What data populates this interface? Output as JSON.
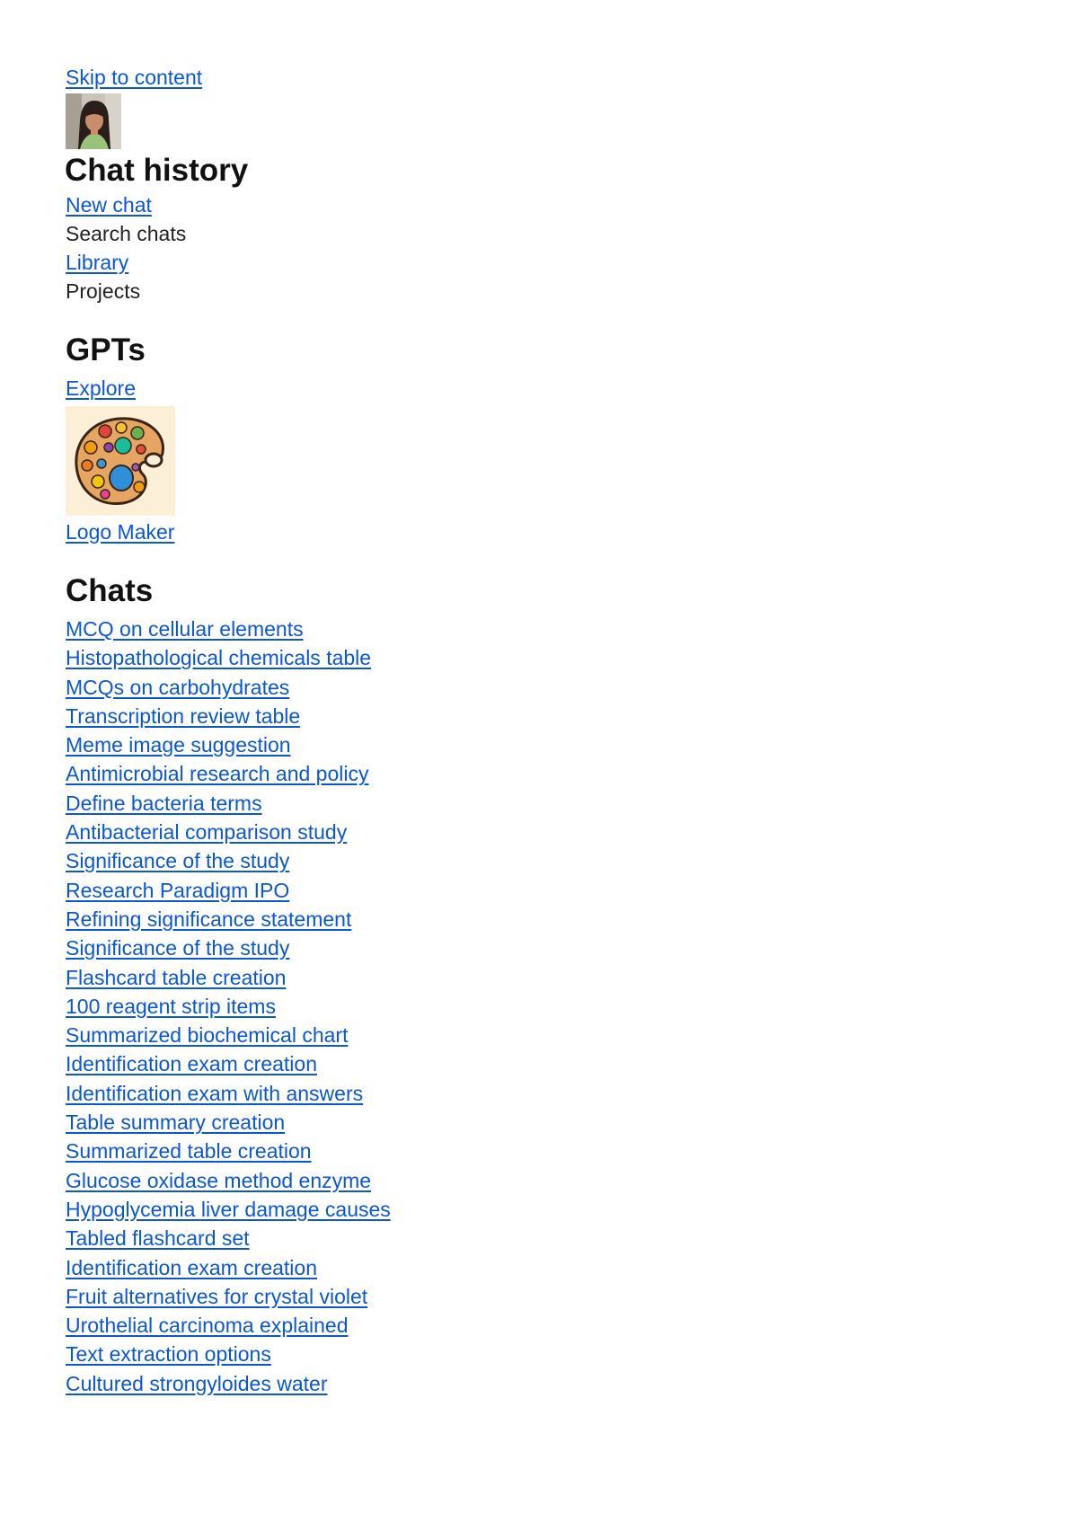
{
  "skip_link": "Skip to content",
  "sidebar": {
    "heading": "Chat history",
    "nav": {
      "new_chat": "New chat",
      "search_chats": "Search chats",
      "library": "Library",
      "projects": "Projects"
    }
  },
  "gpts": {
    "heading": "GPTs",
    "explore": "Explore",
    "items": [
      {
        "label": "Logo Maker",
        "icon": "palette-logo-icon"
      }
    ]
  },
  "chats": {
    "heading": "Chats",
    "items": [
      "MCQ on cellular elements",
      "Histopathological chemicals table",
      "MCQs on carbohydrates",
      "Transcription review table",
      "Meme image suggestion",
      "Antimicrobial research and policy",
      "Define bacteria terms",
      "Antibacterial comparison study",
      "Significance of the study",
      "Research Paradigm IPO",
      "Refining significance statement",
      "Significance of the study",
      "Flashcard table creation",
      "100 reagent strip items",
      "Summarized biochemical chart",
      "Identification exam creation",
      "Identification exam with answers",
      "Table summary creation",
      "Summarized table creation",
      "Glucose oxidase method enzyme",
      "Hypoglycemia liver damage causes",
      "Tabled flashcard set",
      "Identification exam creation",
      "Fruit alternatives for crystal violet",
      "Urothelial carcinoma explained",
      "Text extraction options",
      "Cultured strongyloides water"
    ]
  },
  "colors": {
    "link": "#0b57d0",
    "text": "#1a1a1a"
  }
}
